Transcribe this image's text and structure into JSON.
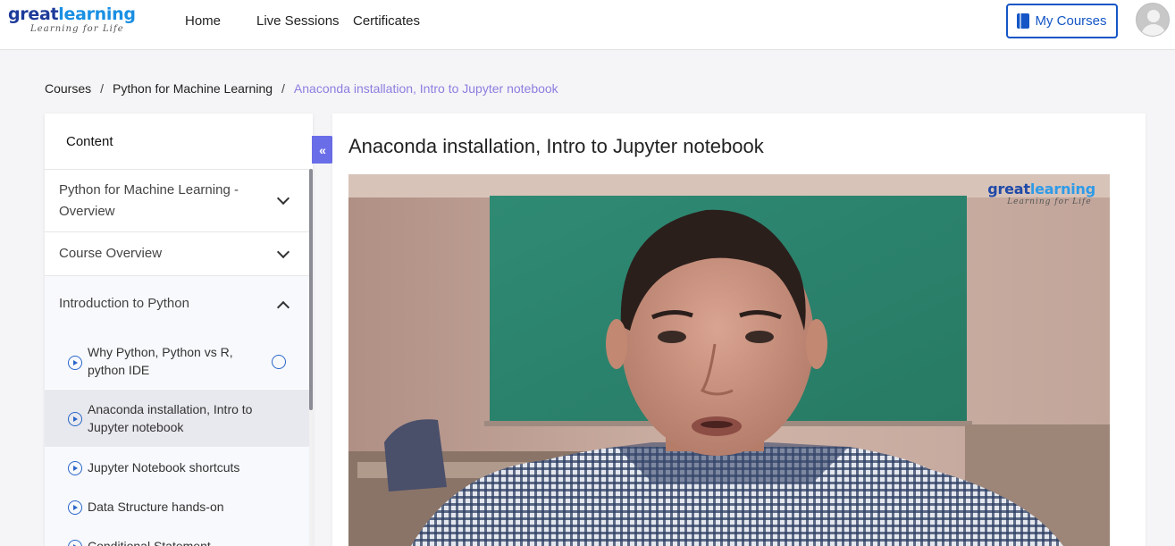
{
  "header": {
    "logo_part1": "great",
    "logo_part2": "learning",
    "logo_tagline": "Learning for Life",
    "nav": [
      "Home",
      "Live Sessions",
      "Certificates"
    ],
    "my_courses_label": "My Courses"
  },
  "breadcrumb": {
    "items": [
      "Courses",
      "Python for Machine Learning",
      "Anaconda installation, Intro to Jupyter notebook"
    ],
    "separator": "/"
  },
  "sidebar": {
    "title": "Content",
    "collapse_glyph": "«",
    "modules": [
      {
        "label_line1": "Python for Machine Learning -",
        "label_line2": "Overview",
        "expanded": false
      },
      {
        "label": "Course Overview",
        "expanded": false
      },
      {
        "label": "Introduction to Python",
        "expanded": true
      }
    ],
    "lessons": [
      {
        "line1": "Why Python, Python vs R,",
        "line2": "python IDE",
        "status": "not-started"
      },
      {
        "line1": "Anaconda installation, Intro to",
        "line2": "Jupyter notebook",
        "active": true
      },
      {
        "label": "Jupyter Notebook shortcuts"
      },
      {
        "label": "Data Structure hands-on"
      },
      {
        "label": "Conditional Statement"
      }
    ]
  },
  "main": {
    "title": "Anaconda installation, Intro to Jupyter notebook",
    "video_watermark_part1": "great",
    "video_watermark_part2": "learning",
    "video_watermark_tagline": "Learning for Life"
  },
  "colors": {
    "accent": "#1456c6",
    "breadcrumb_active": "#8c7ee0",
    "collapse_button": "#6a6de8",
    "play_icon": "#2a66c9"
  }
}
